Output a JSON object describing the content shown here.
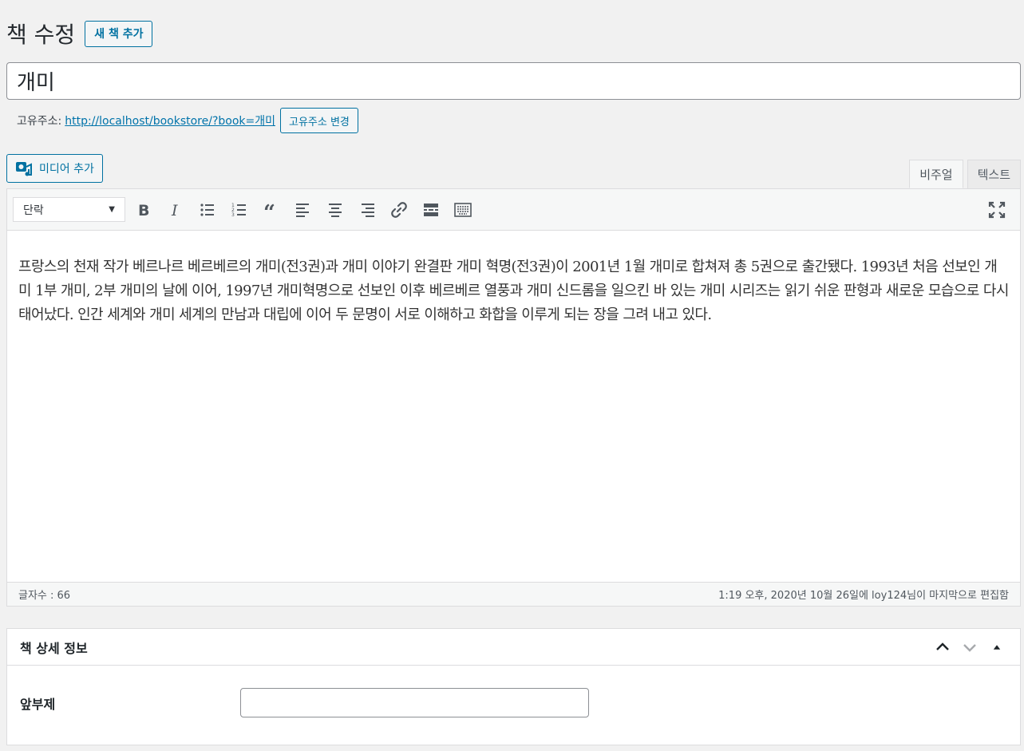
{
  "header": {
    "title": "책 수정",
    "add_new_label": "새 책 추가"
  },
  "post": {
    "title_value": "개미",
    "permalink_label": "고유주소:",
    "permalink_url": "http://localhost/bookstore/?book=개미",
    "permalink_edit_label": "고유주소 변경"
  },
  "editor": {
    "add_media_label": "미디어 추가",
    "tabs": [
      {
        "label": "비주얼",
        "active": true
      },
      {
        "label": "텍스트",
        "active": false
      }
    ],
    "format_select_value": "단락",
    "toolbar_icons": [
      "bold-icon",
      "italic-icon",
      "bulleted-list-icon",
      "numbered-list-icon",
      "blockquote-icon",
      "align-left-icon",
      "align-center-icon",
      "align-right-icon",
      "link-icon",
      "read-more-icon",
      "toolbar-toggle-icon",
      "fullscreen-icon"
    ],
    "content": "프랑스의 천재 작가 베르나르 베르베르의 개미(전3권)과 개미 이야기 완결판 개미 혁명(전3권)이 2001년 1월 개미로 합쳐져 총 5권으로 출간됐다. 1993년 처음 선보인 개미 1부 개미, 2부 개미의 날에 이어, 1997년 개미혁명으로 선보인 이후 베르베르 열풍과 개미 신드롬을 일으킨 바 있는 개미 시리즈는 읽기 쉬운 판형과 새로운 모습으로 다시 태어났다. 인간 세계와 개미 세계의 만남과 대립에 이어 두 문명이 서로 이해하고 화합을 이루게 되는 장을 그려 내고 있다.",
    "word_count": "글자수 : 66",
    "last_edited": "1:19 오후, 2020년 10월 26일에 loy124님이 마지막으로 편집함"
  },
  "details_box": {
    "title": "책 상세 정보",
    "fields": [
      {
        "label": "앞부제",
        "value": ""
      }
    ]
  },
  "colors": {
    "accent": "#0071a1",
    "background": "#f1f1f1"
  }
}
